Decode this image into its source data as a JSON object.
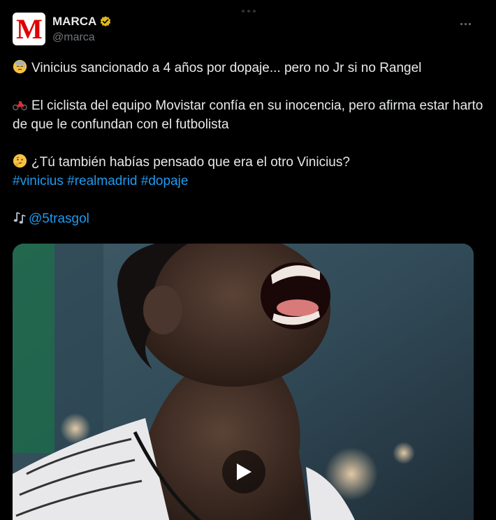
{
  "author": {
    "display_name": "MARCA",
    "handle": "@marca",
    "avatar_letter": "M",
    "verified": true
  },
  "post": {
    "line1": "Vinicius sancionado a 4 años por dopaje... pero no Jr si no Rangel",
    "line2": "El ciclista del equipo Movistar confía en su inocencia, pero afirma estar harto de que le confundan con el futbolista",
    "line3": "¿Tú también habías pensado que era el otro Vinicius?",
    "hashtags": [
      "#vinicius",
      "#realmadrid",
      "#dopaje"
    ],
    "credit": "@5trasgol"
  },
  "icons": {
    "line1": "sweat-face-emoji",
    "line2": "motorcycle-emoji",
    "line3": "thinking-face-emoji",
    "credit": "music-notes-emoji"
  },
  "colors": {
    "background": "#000000",
    "text": "#e7e9ea",
    "secondary": "#71767b",
    "link": "#1d9bf0",
    "verified": "#e2b719",
    "brand": "#e00000"
  }
}
